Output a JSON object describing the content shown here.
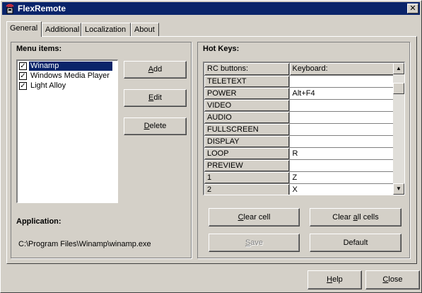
{
  "window": {
    "title": "FlexRemote"
  },
  "tabs": [
    {
      "label": "General",
      "active": true
    },
    {
      "label": "Additional"
    },
    {
      "label": "Localization"
    },
    {
      "label": "About"
    }
  ],
  "menu": {
    "title": "Menu items:",
    "items": [
      {
        "label": "Winamp",
        "checked": true,
        "selected": true
      },
      {
        "label": "Windows Media Player",
        "checked": true
      },
      {
        "label": "Light Alloy",
        "checked": true
      }
    ],
    "add_label_a": "A",
    "add_label_b": "dd",
    "edit_label_a": "E",
    "edit_label_b": "dit",
    "delete_label_a": "D",
    "delete_label_b": "elete"
  },
  "application": {
    "title": "Application:",
    "path": "C:\\Program Files\\Winamp\\winamp.exe"
  },
  "hotkeys": {
    "title": "Hot Keys:",
    "columns": [
      "RC buttons:",
      "Keyboard:"
    ],
    "rows": [
      {
        "button": "TELETEXT",
        "key": ""
      },
      {
        "button": "POWER",
        "key": "Alt+F4"
      },
      {
        "button": "VIDEO",
        "key": ""
      },
      {
        "button": "AUDIO",
        "key": ""
      },
      {
        "button": "FULLSCREEN",
        "key": ""
      },
      {
        "button": "DISPLAY",
        "key": ""
      },
      {
        "button": "LOOP",
        "key": "R"
      },
      {
        "button": "PREVIEW",
        "key": ""
      },
      {
        "button": "1",
        "key": "Z"
      },
      {
        "button": "2",
        "key": "X"
      }
    ],
    "clear_cell_a": "C",
    "clear_cell_b": "lear cell",
    "clear_all_a": "Clear ",
    "clear_all_b": "a",
    "clear_all_c": "ll cells",
    "save_a": "S",
    "save_b": "ave",
    "default_label": "Default"
  },
  "footer": {
    "help_a": "H",
    "help_b": "elp",
    "close_a": "C",
    "close_b": "lose"
  }
}
